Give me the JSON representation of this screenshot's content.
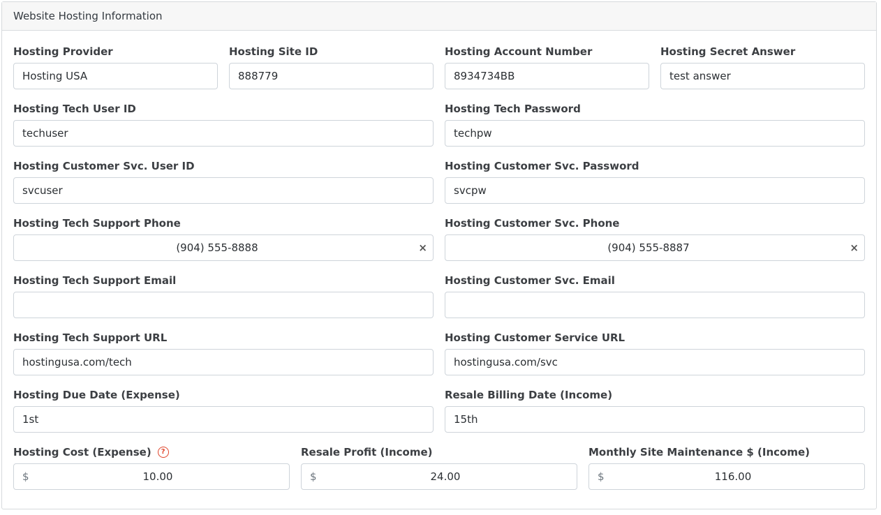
{
  "panel": {
    "title": "Website Hosting Information"
  },
  "row1": [
    {
      "label": "Hosting Provider",
      "value": "Hosting USA"
    },
    {
      "label": "Hosting Site ID",
      "value": "888779"
    },
    {
      "label": "Hosting Account Number",
      "value": "8934734BB"
    },
    {
      "label": "Hosting Secret Answer",
      "value": "test answer"
    }
  ],
  "tech_user": {
    "label": "Hosting Tech User ID",
    "value": "techuser"
  },
  "tech_password": {
    "label": "Hosting Tech Password",
    "value": "techpw"
  },
  "svc_user": {
    "label": "Hosting Customer Svc. User ID",
    "value": "svcuser"
  },
  "svc_password": {
    "label": "Hosting Customer Svc. Password",
    "value": "svcpw"
  },
  "tech_phone": {
    "label": "Hosting Tech Support Phone",
    "value": "(904) 555-8888",
    "clear_icon": "×"
  },
  "svc_phone": {
    "label": "Hosting Customer Svc. Phone",
    "value": "(904) 555-8887",
    "clear_icon": "×"
  },
  "tech_email": {
    "label": "Hosting Tech Support Email",
    "value": ""
  },
  "svc_email": {
    "label": "Hosting Customer Svc. Email",
    "value": ""
  },
  "tech_url": {
    "label": "Hosting Tech Support URL",
    "value": "hostingusa.com/tech"
  },
  "svc_url": {
    "label": "Hosting Customer Service URL",
    "value": "hostingusa.com/svc"
  },
  "due_date": {
    "label": "Hosting Due Date (Expense)",
    "value": "1st"
  },
  "billing_date": {
    "label": "Resale Billing Date (Income)",
    "value": "15th"
  },
  "hosting_cost": {
    "label": "Hosting Cost (Expense)",
    "currency": "$",
    "value": "10.00",
    "help_icon": "?"
  },
  "resale_profit": {
    "label": "Resale Profit (Income)",
    "currency": "$",
    "value": "24.00"
  },
  "maintenance": {
    "label": "Monthly Site Maintenance $ (Income)",
    "currency": "$",
    "value": "116.00"
  }
}
